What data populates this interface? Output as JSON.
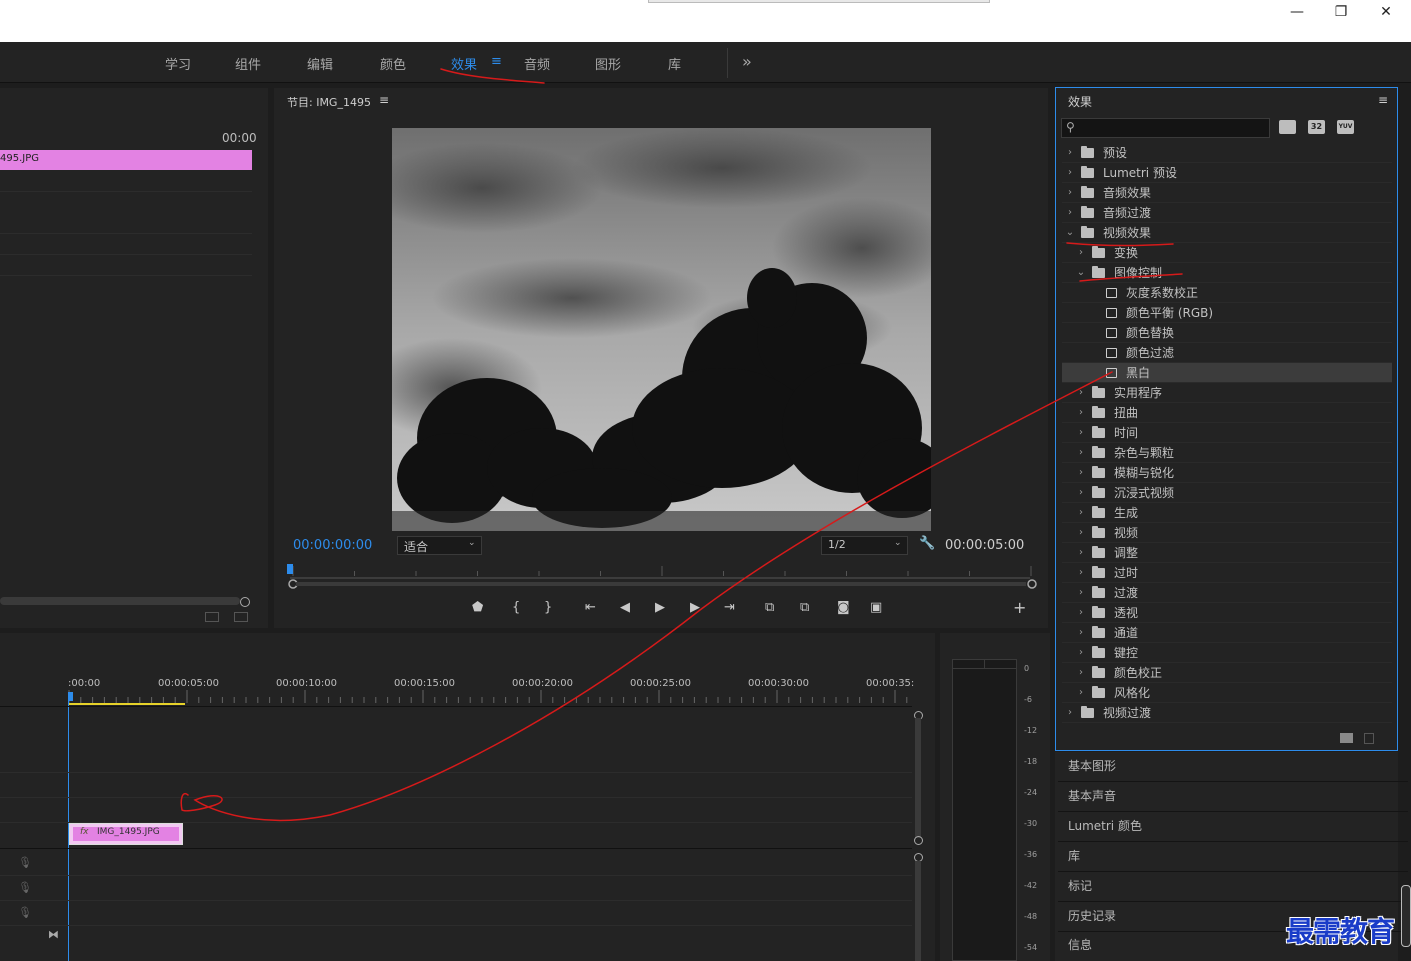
{
  "window": {
    "minimize_glyph": "—",
    "maximize_glyph": "❐",
    "close_glyph": "✕"
  },
  "workspaces": {
    "tabs": [
      "学习",
      "组件",
      "编辑",
      "颜色",
      "效果",
      "音频",
      "图形",
      "库"
    ],
    "active_index": 4,
    "menu_glyph": "≡",
    "more_glyph": "»"
  },
  "project": {
    "timecode": "00:00",
    "clip_label": "495.JPG"
  },
  "program": {
    "title": "节目: IMG_1495",
    "menu_glyph": "≡",
    "current_time": "00:00:00:00",
    "fit_label": "适合",
    "resolution": "1/2",
    "duration": "00:00:05:00",
    "add_glyph": "+"
  },
  "effects": {
    "title": "效果",
    "menu_glyph": "≡",
    "search_placeholder": "",
    "badges": [
      "32",
      "YUV"
    ],
    "tree": [
      {
        "label": "预设",
        "depth": 0,
        "open": false,
        "kind": "preset"
      },
      {
        "label": "Lumetri 预设",
        "depth": 0,
        "open": false,
        "kind": "preset"
      },
      {
        "label": "音频效果",
        "depth": 0,
        "open": false,
        "kind": "folder"
      },
      {
        "label": "音频过渡",
        "depth": 0,
        "open": false,
        "kind": "folder"
      },
      {
        "label": "视频效果",
        "depth": 0,
        "open": true,
        "kind": "folder"
      },
      {
        "label": "变换",
        "depth": 1,
        "open": false,
        "kind": "folder"
      },
      {
        "label": "图像控制",
        "depth": 1,
        "open": true,
        "kind": "folder"
      },
      {
        "label": "灰度系数校正",
        "depth": 2,
        "kind": "effect"
      },
      {
        "label": "颜色平衡 (RGB)",
        "depth": 2,
        "kind": "effect"
      },
      {
        "label": "颜色替换",
        "depth": 2,
        "kind": "effect"
      },
      {
        "label": "颜色过滤",
        "depth": 2,
        "kind": "effect"
      },
      {
        "label": "黑白",
        "depth": 2,
        "kind": "effect",
        "selected": true
      },
      {
        "label": "实用程序",
        "depth": 1,
        "open": false,
        "kind": "folder"
      },
      {
        "label": "扭曲",
        "depth": 1,
        "open": false,
        "kind": "folder"
      },
      {
        "label": "时间",
        "depth": 1,
        "open": false,
        "kind": "folder"
      },
      {
        "label": "杂色与颗粒",
        "depth": 1,
        "open": false,
        "kind": "folder"
      },
      {
        "label": "模糊与锐化",
        "depth": 1,
        "open": false,
        "kind": "folder"
      },
      {
        "label": "沉浸式视频",
        "depth": 1,
        "open": false,
        "kind": "folder"
      },
      {
        "label": "生成",
        "depth": 1,
        "open": false,
        "kind": "folder"
      },
      {
        "label": "视频",
        "depth": 1,
        "open": false,
        "kind": "folder"
      },
      {
        "label": "调整",
        "depth": 1,
        "open": false,
        "kind": "folder"
      },
      {
        "label": "过时",
        "depth": 1,
        "open": false,
        "kind": "folder"
      },
      {
        "label": "过渡",
        "depth": 1,
        "open": false,
        "kind": "folder"
      },
      {
        "label": "透视",
        "depth": 1,
        "open": false,
        "kind": "folder"
      },
      {
        "label": "通道",
        "depth": 1,
        "open": false,
        "kind": "folder"
      },
      {
        "label": "键控",
        "depth": 1,
        "open": false,
        "kind": "folder"
      },
      {
        "label": "颜色校正",
        "depth": 1,
        "open": false,
        "kind": "folder"
      },
      {
        "label": "风格化",
        "depth": 1,
        "open": false,
        "kind": "folder"
      },
      {
        "label": "视频过渡",
        "depth": 0,
        "open": false,
        "kind": "folder"
      }
    ]
  },
  "side_panels": [
    "基本图形",
    "基本声音",
    "Lumetri 颜色",
    "库",
    "标记",
    "历史记录",
    "信息"
  ],
  "timeline": {
    "ruler": [
      ":00:00",
      "00:00:05:00",
      "00:00:10:00",
      "00:00:15:00",
      "00:00:20:00",
      "00:00:25:00",
      "00:00:30:00",
      "00:00:35:"
    ],
    "clip_label": "IMG_1495.JPG",
    "clip_fx": "fx"
  },
  "meter": {
    "labels": [
      "0",
      "-6",
      "-12",
      "-18",
      "-24",
      "-30",
      "-36",
      "-42",
      "-48",
      "-54"
    ]
  },
  "watermark": "最需教育",
  "colors": {
    "accent": "#2d8ceb",
    "clip": "#e382e3",
    "annotation": "#d61a1a",
    "panel": "#232323"
  }
}
